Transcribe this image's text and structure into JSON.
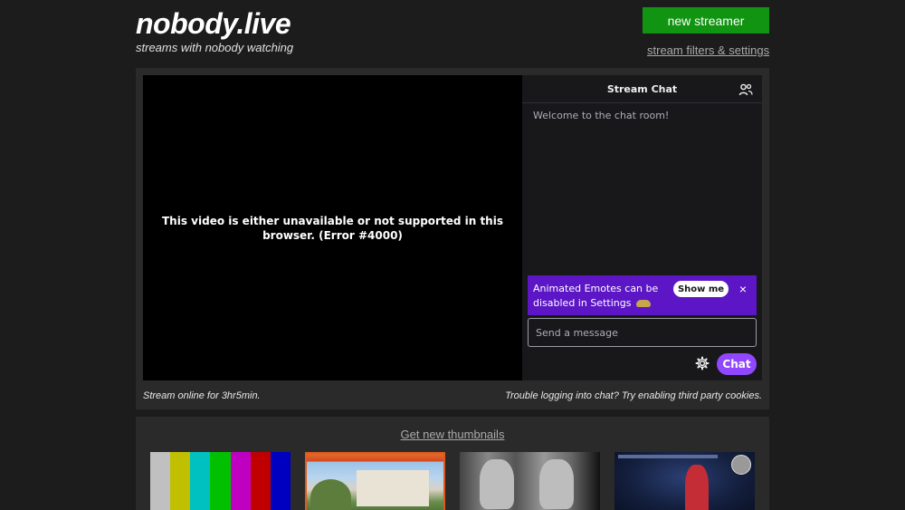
{
  "header": {
    "title": "nobody.live",
    "subtitle": "streams with nobody watching",
    "new_streamer_label": "new streamer",
    "filters_label": "stream filters & settings"
  },
  "player": {
    "error_message": "This video is either unavailable or not supported in this browser. (Error #4000)"
  },
  "chat": {
    "title": "Stream Chat",
    "welcome": "Welcome to the chat room!",
    "banner": {
      "text": "Animated Emotes can be disabled in Settings",
      "button_label": "Show me",
      "close_label": "×"
    },
    "input_placeholder": "Send a message",
    "send_label": "Chat",
    "colors": {
      "banner_bg": "#5c16c5",
      "send_button": "#9147ff"
    }
  },
  "status": {
    "online": "Stream online for 3hr5min.",
    "trouble": "Trouble logging into chat? Try enabling third party cookies."
  },
  "thumbnails": {
    "refresh_label": "Get new thumbnails",
    "test_pattern_colors": [
      "#c0c0c0",
      "#c0c000",
      "#00c0c0",
      "#00c000",
      "#c000c0",
      "#c00000",
      "#0000c0"
    ]
  },
  "colors": {
    "accent_green": "#119411",
    "page_bg": "#1c1c1c",
    "panel_bg": "#2a2a2a"
  }
}
